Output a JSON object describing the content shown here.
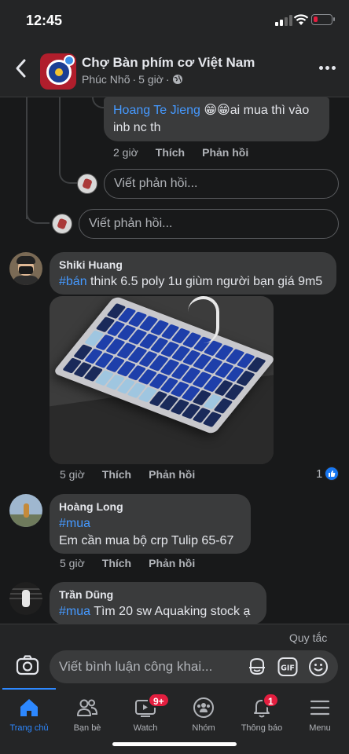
{
  "status": {
    "time": "12:45"
  },
  "header": {
    "title": "Chợ Bàn phím cơ Việt Nam",
    "author": "Phúc Nhõ",
    "separator": "·",
    "age": "5 giờ"
  },
  "reply_hoang": {
    "mention": "Hoang Te Jieng",
    "emoji": "😁😁",
    "text_line1": "ai mua thì vào",
    "text_line2": "inb nc th",
    "time": "2 giờ",
    "like": "Thích",
    "reply": "Phản hồi"
  },
  "reply_input_nested": {
    "placeholder": "Viết phản hồi..."
  },
  "reply_input_top": {
    "placeholder": "Viết phản hồi..."
  },
  "comments": [
    {
      "name": "Shiki Huang",
      "hashtag": "#bán",
      "text": " think 6.5 poly 1u giùm người bạn giá 9m5",
      "time": "5 giờ",
      "like": "Thích",
      "reply": "Phản hồi",
      "reaction_count": "1"
    },
    {
      "name": "Hoàng Long",
      "hashtag": "#mua",
      "text": "Em cần mua bộ crp Tulip 65-67",
      "time": "5 giờ",
      "like": "Thích",
      "reply": "Phản hồi"
    },
    {
      "name": "Trần Dũng",
      "hashtag": "#mua",
      "text": " Tìm 20 sw Aquaking stock ạ"
    }
  ],
  "composer": {
    "rules": "Quy tắc",
    "placeholder": "Viết bình luận công khai..."
  },
  "tabs": [
    {
      "label": "Trang chủ",
      "icon": "home-icon",
      "active": true
    },
    {
      "label": "Bạn bè",
      "icon": "friends-icon"
    },
    {
      "label": "Watch",
      "icon": "watch-icon",
      "badge": "9+"
    },
    {
      "label": "Nhóm",
      "icon": "groups-icon"
    },
    {
      "label": "Thông báo",
      "icon": "bell-icon",
      "badge": "1"
    },
    {
      "label": "Menu",
      "icon": "menu-icon"
    }
  ],
  "colors": {
    "accent": "#2d88ff",
    "link": "#4599ff",
    "badge": "#e41e3f",
    "bubble": "#3a3b3c",
    "background": "#18191a"
  }
}
